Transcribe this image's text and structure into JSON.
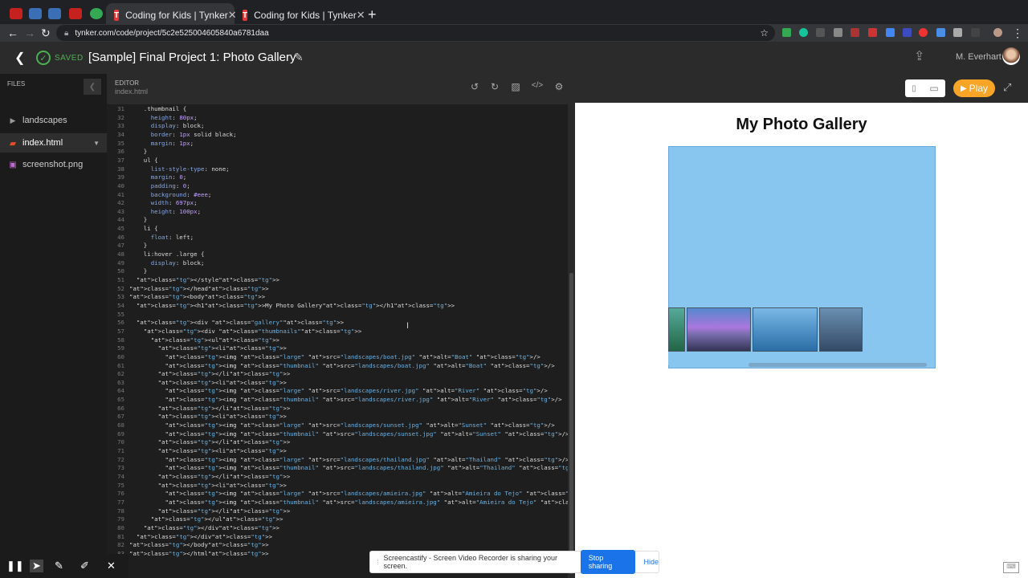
{
  "browser": {
    "tabs": [
      {
        "label": "Coding for Kids | Tynker",
        "active": true
      },
      {
        "label": "Coding for Kids | Tynker",
        "active": false
      }
    ],
    "url": "tynker.com/code/project/5c2e525004605840a6781daa"
  },
  "app": {
    "status": "SAVED",
    "project_title": "[Sample] Final Project 1: Photo Gallery",
    "user_name": "M. Everhart"
  },
  "files": {
    "header": "FILES",
    "items": [
      {
        "name": "landscapes",
        "type": "folder"
      },
      {
        "name": "index.html",
        "type": "html",
        "selected": true
      },
      {
        "name": "screenshot.png",
        "type": "image"
      }
    ]
  },
  "editor": {
    "label": "EDITOR",
    "filename": "index.html",
    "lines": [
      {
        "n": "31",
        "t": "    .thumbnail {"
      },
      {
        "n": "32",
        "t": "      height: 80px;"
      },
      {
        "n": "33",
        "t": "      display: block;"
      },
      {
        "n": "34",
        "t": "      border: 1px solid black;"
      },
      {
        "n": "35",
        "t": "      margin: 1px;"
      },
      {
        "n": "36",
        "t": "    }"
      },
      {
        "n": "37",
        "t": "    ul {"
      },
      {
        "n": "38",
        "t": "      list-style-type: none;"
      },
      {
        "n": "39",
        "t": "      margin: 0;"
      },
      {
        "n": "40",
        "t": "      padding: 0;"
      },
      {
        "n": "41",
        "t": "      background: #eee;"
      },
      {
        "n": "42",
        "t": "      width: 697px;"
      },
      {
        "n": "43",
        "t": "      height: 100px;"
      },
      {
        "n": "44",
        "t": "    }"
      },
      {
        "n": "45",
        "t": "    li {"
      },
      {
        "n": "46",
        "t": "      float: left;"
      },
      {
        "n": "47",
        "t": "    }"
      },
      {
        "n": "48",
        "t": "    li:hover .large {"
      },
      {
        "n": "49",
        "t": "      display: block;"
      },
      {
        "n": "50",
        "t": "    }"
      },
      {
        "n": "51",
        "t": "  </style>"
      },
      {
        "n": "52",
        "t": "</head>"
      },
      {
        "n": "53",
        "t": "<body>"
      },
      {
        "n": "54",
        "t": "  <h1>My Photo Gallery</h1>"
      },
      {
        "n": "55",
        "t": ""
      },
      {
        "n": "56",
        "t": "  <div class=\"gallery\">"
      },
      {
        "n": "57",
        "t": "    <div class=\"thumbnails\">"
      },
      {
        "n": "58",
        "t": "      <ul>"
      },
      {
        "n": "59",
        "t": "        <li>"
      },
      {
        "n": "60",
        "t": "          <img class=\"large\" src=\"landscapes/boat.jpg\" alt=\"Boat\" />"
      },
      {
        "n": "61",
        "t": "          <img class=\"thumbnail\" src=\"landscapes/boat.jpg\" alt=\"Boat\" />"
      },
      {
        "n": "62",
        "t": "        </li>"
      },
      {
        "n": "63",
        "t": "        <li>"
      },
      {
        "n": "64",
        "t": "          <img class=\"large\" src=\"landscapes/river.jpg\" alt=\"River\" />"
      },
      {
        "n": "65",
        "t": "          <img class=\"thumbnail\" src=\"landscapes/river.jpg\" alt=\"River\" />"
      },
      {
        "n": "66",
        "t": "        </li>"
      },
      {
        "n": "67",
        "t": "        <li>"
      },
      {
        "n": "68",
        "t": "          <img class=\"large\" src=\"landscapes/sunset.jpg\" alt=\"Sunset\" />"
      },
      {
        "n": "69",
        "t": "          <img class=\"thumbnail\" src=\"landscapes/sunset.jpg\" alt=\"Sunset\" />"
      },
      {
        "n": "70",
        "t": "        </li>"
      },
      {
        "n": "71",
        "t": "        <li>"
      },
      {
        "n": "72",
        "t": "          <img class=\"large\" src=\"landscapes/thailand.jpg\" alt=\"Thailand\" />"
      },
      {
        "n": "73",
        "t": "          <img class=\"thumbnail\" src=\"landscapes/thailand.jpg\" alt=\"Thailand\" />"
      },
      {
        "n": "74",
        "t": "        </li>"
      },
      {
        "n": "75",
        "t": "        <li>"
      },
      {
        "n": "76",
        "t": "          <img class=\"large\" src=\"landscapes/amieira.jpg\" alt=\"Amieira do Tejo\" />"
      },
      {
        "n": "77",
        "t": "          <img class=\"thumbnail\" src=\"landscapes/amieira.jpg\" alt=\"Amieira do Tejo\" />"
      },
      {
        "n": "78",
        "t": "        </li>"
      },
      {
        "n": "79",
        "t": "      </ul>"
      },
      {
        "n": "80",
        "t": "    </div>"
      },
      {
        "n": "81",
        "t": "  </div>"
      },
      {
        "n": "82",
        "t": "</body>"
      },
      {
        "n": "83",
        "t": "</html>"
      }
    ]
  },
  "preview": {
    "play_label": "Play",
    "gallery_title": "My Photo Gallery",
    "gallery_bg": "#88c5ef"
  },
  "overlay": {
    "share_message": "Screencastify - Screen Video Recorder is sharing your screen.",
    "stop_label": "Stop sharing",
    "hide_label": "Hide"
  }
}
